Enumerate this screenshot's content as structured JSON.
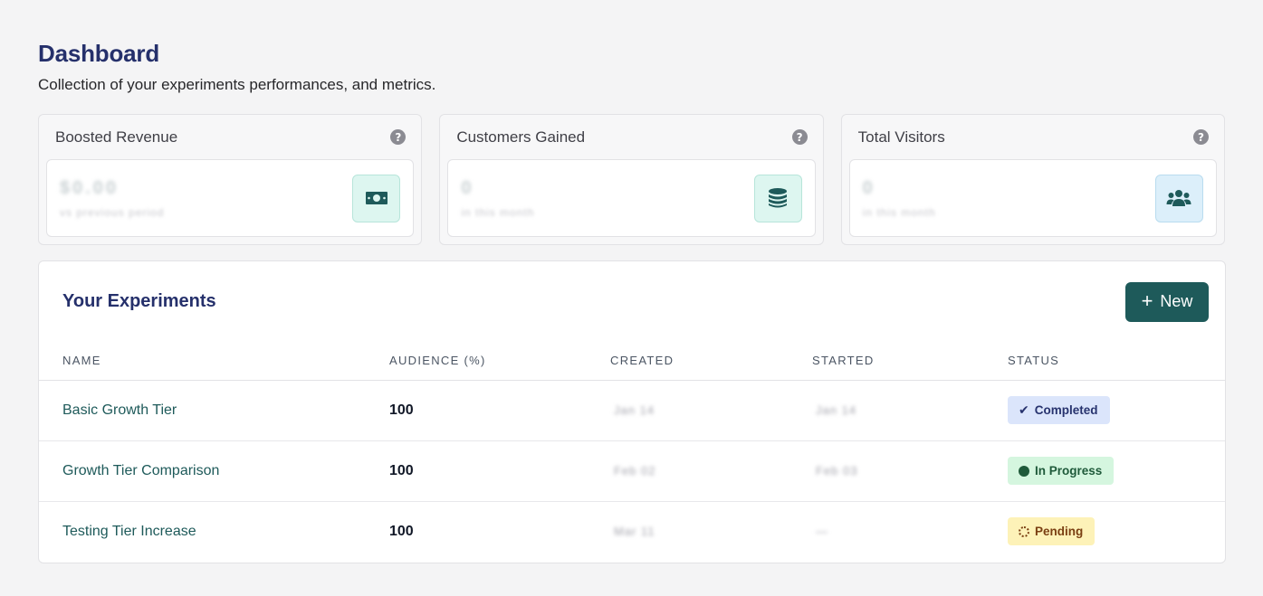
{
  "page": {
    "title": "Dashboard",
    "subtitle": "Collection of your experiments performances, and metrics."
  },
  "stats": [
    {
      "title": "Boosted Revenue",
      "value": "$0.00",
      "sub": "vs previous period",
      "icon": "money-bill-icon",
      "accent": "#ddf6f0"
    },
    {
      "title": "Customers Gained",
      "value": "0",
      "sub": "in this month",
      "icon": "coins-stack-icon",
      "accent": "#ddf6f0"
    },
    {
      "title": "Total Visitors",
      "value": "0",
      "sub": "in this month",
      "icon": "users-group-icon",
      "accent": "#dceffa"
    }
  ],
  "experiments": {
    "title": "Your Experiments",
    "new_label": "New",
    "columns": [
      "NAME",
      "AUDIENCE (%)",
      "CREATED",
      "STARTED",
      "STATUS"
    ],
    "rows": [
      {
        "name": "Basic Growth Tier",
        "audience": "100",
        "created": "Jan 14",
        "started": "Jan 14",
        "status": "Completed"
      },
      {
        "name": "Growth Tier Comparison",
        "audience": "100",
        "created": "Feb 02",
        "started": "Feb 03",
        "status": "In Progress"
      },
      {
        "name": "Testing Tier Increase",
        "audience": "100",
        "created": "Mar 11",
        "started": "—",
        "status": "Pending"
      }
    ]
  },
  "colors": {
    "brand": "#1e5a5a",
    "heading": "#25306b",
    "completed": "#dbe5fb",
    "in_progress": "#d5f6df",
    "pending": "#fdf2b8"
  }
}
